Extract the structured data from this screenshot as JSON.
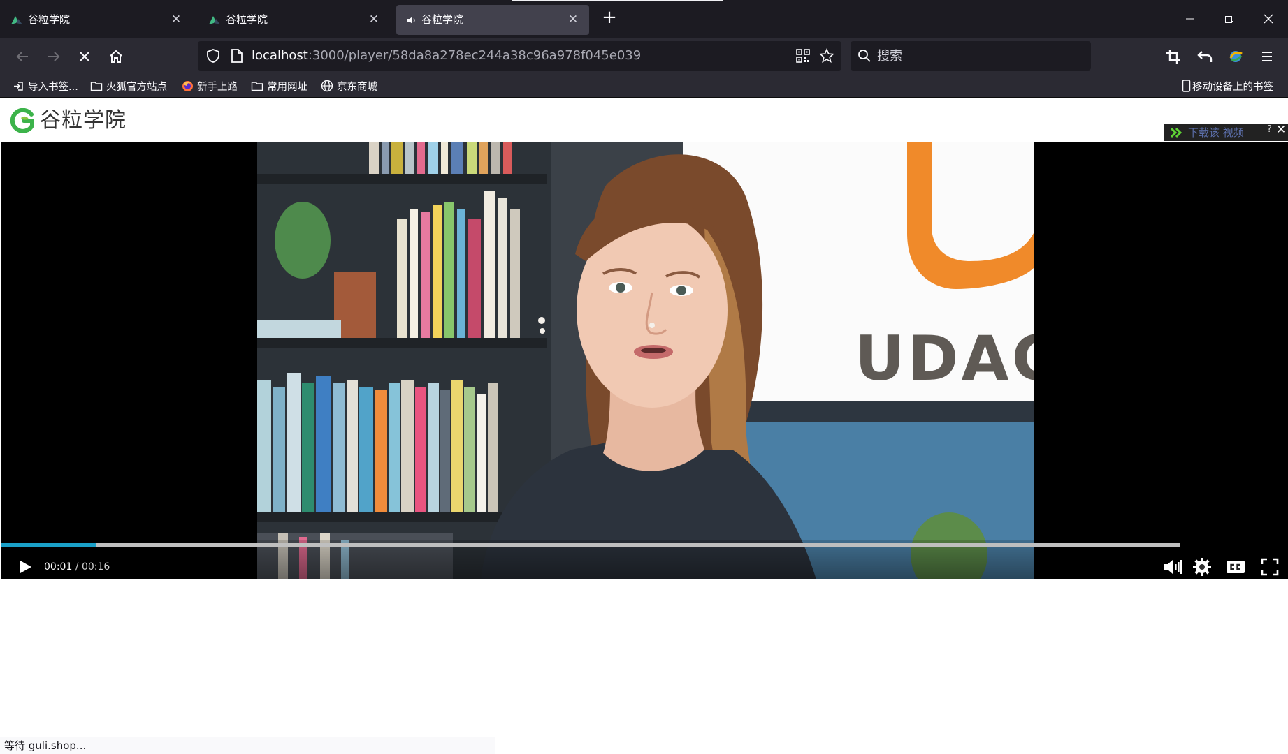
{
  "browser": {
    "tabs": [
      {
        "title": "谷粒学院",
        "icon": "vuetify-icon",
        "active": false
      },
      {
        "title": "谷粒学院",
        "icon": "vuetify-icon",
        "active": false
      },
      {
        "title": "谷粒学院",
        "icon": "speaker-icon",
        "active": true
      }
    ],
    "url_host": "localhost",
    "url_rest": ":3000/player/58da8a278ec244a38c96a978f045e039",
    "search_placeholder": "搜索",
    "bookmarks": [
      {
        "label": "导入书签...",
        "icon": "import-icon"
      },
      {
        "label": "火狐官方站点",
        "icon": "folder-icon"
      },
      {
        "label": "新手上路",
        "icon": "firefox-icon"
      },
      {
        "label": "常用网址",
        "icon": "folder-icon"
      },
      {
        "label": "京东商城",
        "icon": "globe-icon"
      }
    ],
    "mobile_bookmarks": "移动设备上的书签",
    "status_text": "等待 guli.shop..."
  },
  "site": {
    "logo_text": "谷粒学院",
    "brand_color": "#3cb34a"
  },
  "download_widget": {
    "label": "下载该 视频",
    "help": "?",
    "close": "✕"
  },
  "player": {
    "current_time": "00:01",
    "separator": " / ",
    "duration": "00:16",
    "progress": 0.08,
    "accent_color": "#1aa0c8",
    "video_overlay_text": "UDAC"
  }
}
